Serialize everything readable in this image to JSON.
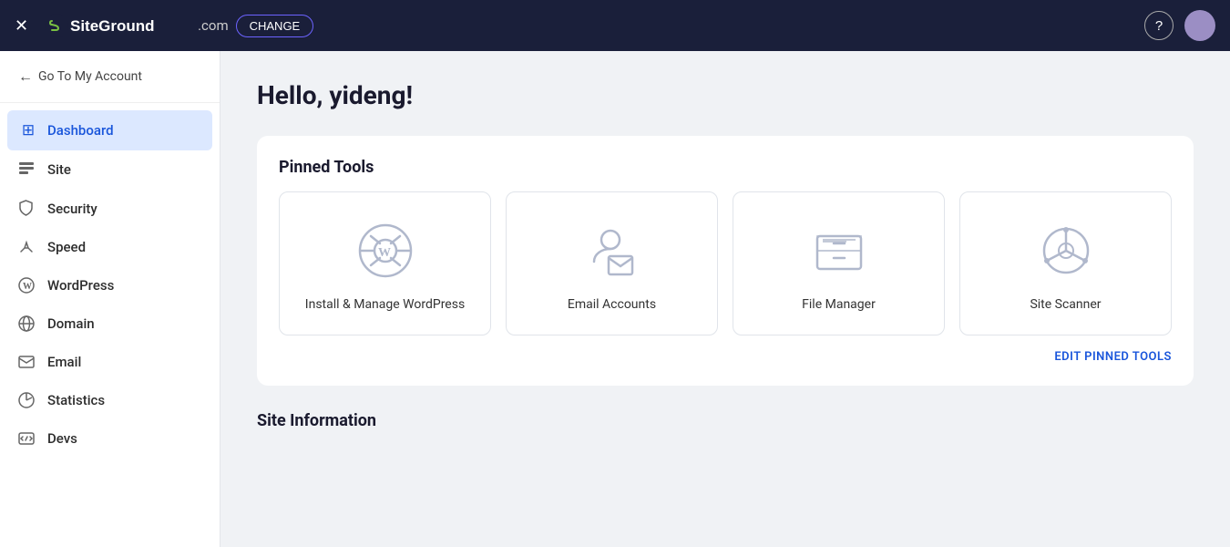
{
  "header": {
    "close_label": "✕",
    "logo_text": "SiteGround",
    "domain_tld": ".com",
    "change_btn": "CHANGE",
    "help_icon": "?",
    "accent_color": "#6c63ff"
  },
  "sidebar": {
    "back_label": "Go To My Account",
    "nav_items": [
      {
        "id": "dashboard",
        "label": "Dashboard",
        "icon": "⊞",
        "active": true
      },
      {
        "id": "site",
        "label": "Site",
        "icon": "☰"
      },
      {
        "id": "security",
        "label": "Security",
        "icon": "🔒"
      },
      {
        "id": "speed",
        "label": "Speed",
        "icon": "⚡"
      },
      {
        "id": "wordpress",
        "label": "WordPress",
        "icon": "Ⓦ"
      },
      {
        "id": "domain",
        "label": "Domain",
        "icon": "🌐"
      },
      {
        "id": "email",
        "label": "Email",
        "icon": "✉"
      },
      {
        "id": "statistics",
        "label": "Statistics",
        "icon": "◔"
      },
      {
        "id": "devs",
        "label": "Devs",
        "icon": "⌨"
      }
    ]
  },
  "main": {
    "greeting": "Hello, yideng!",
    "pinned_tools_title": "Pinned Tools",
    "pinned_tools": [
      {
        "id": "wordpress",
        "label": "Install & Manage WordPress"
      },
      {
        "id": "email-accounts",
        "label": "Email Accounts"
      },
      {
        "id": "file-manager",
        "label": "File Manager"
      },
      {
        "id": "site-scanner",
        "label": "Site Scanner"
      }
    ],
    "edit_pinned_label": "EDIT PINNED TOOLS",
    "site_info_title": "Site Information"
  }
}
